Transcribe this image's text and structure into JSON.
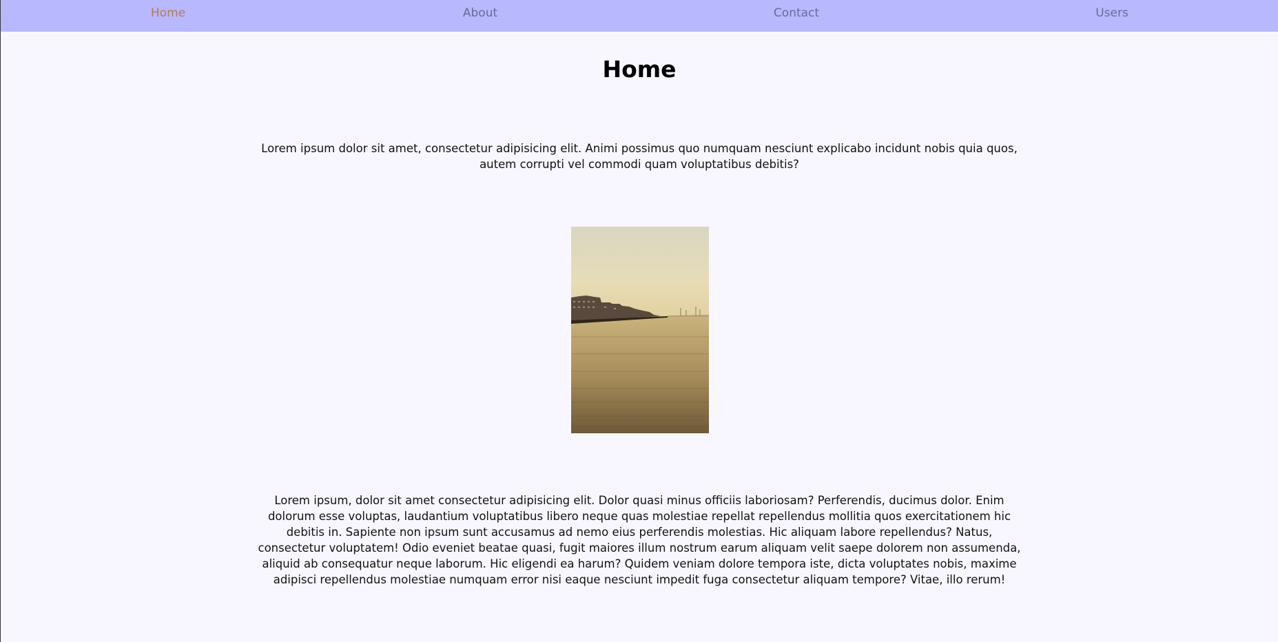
{
  "nav": {
    "items": [
      {
        "label": "Home",
        "active": true
      },
      {
        "label": "About",
        "active": false
      },
      {
        "label": "Contact",
        "active": false
      },
      {
        "label": "Users",
        "active": false
      }
    ]
  },
  "main": {
    "title": "Home",
    "intro": "Lorem ipsum dolor sit amet, consectetur adipisicing elit. Animi possimus quo numquam nesciunt explicabo incidunt nobis quia quos, autem corrupti vel commodi quam voluptatibus debitis?",
    "image_alt": "Waterfront buildings along a calm river under a hazy sky",
    "body": "Lorem ipsum, dolor sit amet consectetur adipisicing elit. Dolor quasi minus officiis laboriosam? Perferendis, ducimus dolor. Enim dolorum esse voluptas, laudantium voluptatibus libero neque quas molestiae repellat repellendus mollitia quos exercitationem hic debitis in. Sapiente non ipsum sunt accusamus ad nemo eius perferendis molestias. Hic aliquam labore repellendus? Natus, consectetur voluptatem! Odio eveniet beatae quasi, fugit maiores illum nostrum earum aliquam velit saepe dolorem non assumenda, aliquid ab consequatur neque laborum. Hic eligendi ea harum? Quidem veniam dolore tempora iste, dicta voluptates nobis, maxime adipisci repellendus molestiae numquam error nisi eaque nesciunt impedit fuga consectetur aliquam tempore? Vitae, illo rerum!"
  },
  "colors": {
    "navbar_bg": "#b8b8ff",
    "page_bg": "#f8f7ff",
    "nav_link": "#6a6a9a",
    "nav_link_active": "#b27a5a"
  }
}
